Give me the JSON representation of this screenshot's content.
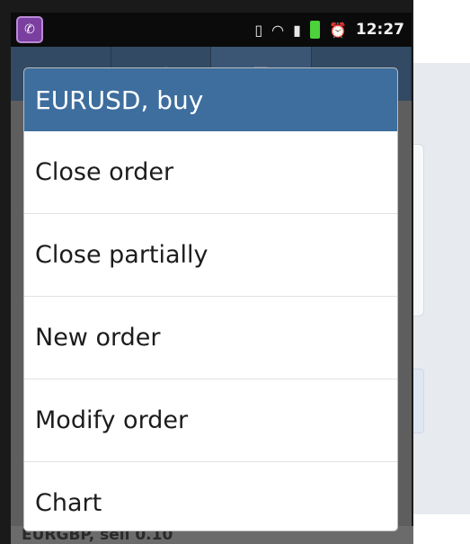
{
  "statusbar": {
    "app_icon": "phone-icon",
    "icons": [
      "vibrate-icon",
      "wifi-icon",
      "signal-icon",
      "battery-icon",
      "alarm-icon"
    ],
    "time": "12:27"
  },
  "dialog": {
    "title": "EURUSD, buy",
    "items": [
      {
        "label": "Close order"
      },
      {
        "label": "Close partially"
      },
      {
        "label": "New order"
      },
      {
        "label": "Modify order"
      },
      {
        "label": "Chart"
      }
    ]
  },
  "background": {
    "bottom_row_text": "EURGBP, sell 0.10"
  },
  "colors": {
    "header": "#3d6e9e",
    "toolbar": "#324a63",
    "battery": "#4cd23b"
  }
}
